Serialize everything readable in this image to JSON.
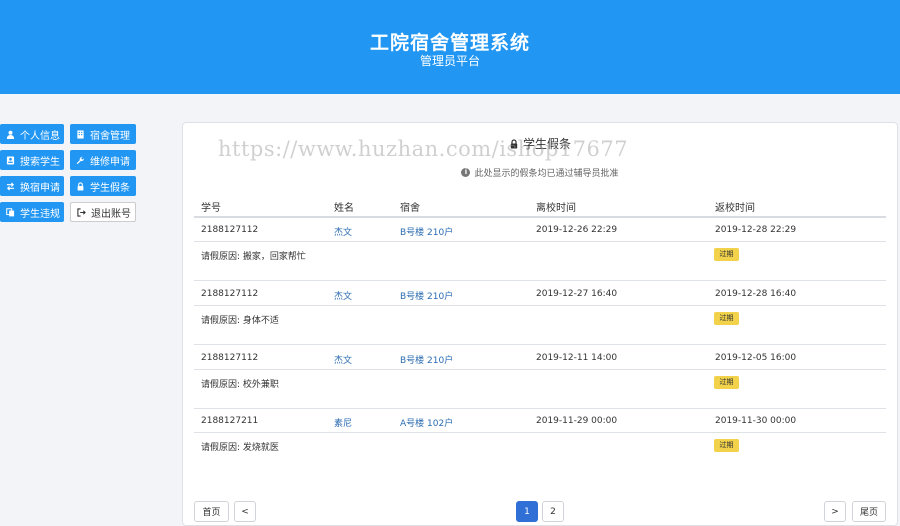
{
  "header": {
    "title": "工院宿舍管理系统",
    "subtitle": "管理员平台"
  },
  "sidebar": {
    "items": [
      {
        "label": "个人信息",
        "icon": "user-icon"
      },
      {
        "label": "宿舍管理",
        "icon": "building-icon"
      },
      {
        "label": "搜索学生",
        "icon": "id-card-icon"
      },
      {
        "label": "维修申请",
        "icon": "wrench-icon"
      },
      {
        "label": "换宿申请",
        "icon": "exchange-icon"
      },
      {
        "label": "学生假条",
        "icon": "lock-icon"
      },
      {
        "label": "学生违规",
        "icon": "copy-icon"
      },
      {
        "label": "退出账号",
        "icon": "sign-out-icon"
      }
    ]
  },
  "card": {
    "title": "学生假条",
    "note": "此处显示的假条均已通过辅导员批准"
  },
  "watermark": "https://www.huzhan.com/ishop17677",
  "table": {
    "columns": [
      "学号",
      "姓名",
      "宿舍",
      "离校时间",
      "返校时间"
    ],
    "rows": [
      {
        "id": "2188127112",
        "name": "杰文",
        "dorm": "B号楼 210户",
        "leave": "2019-12-26 22:29",
        "return": "2019-12-28 22:29",
        "reason": "请假原因: 搬家，回家帮忙",
        "status": "过期"
      },
      {
        "id": "2188127112",
        "name": "杰文",
        "dorm": "B号楼 210户",
        "leave": "2019-12-27 16:40",
        "return": "2019-12-28 16:40",
        "reason": "请假原因: 身体不适",
        "status": "过期"
      },
      {
        "id": "2188127112",
        "name": "杰文",
        "dorm": "B号楼 210户",
        "leave": "2019-12-11 14:00",
        "return": "2019-12-05 16:00",
        "reason": "请假原因: 校外兼职",
        "status": "过期"
      },
      {
        "id": "2188127211",
        "name": "素尼",
        "dorm": "A号楼 102户",
        "leave": "2019-11-29 00:00",
        "return": "2019-11-30 00:00",
        "reason": "请假原因: 发烧就医",
        "status": "过期"
      }
    ]
  },
  "pagination": {
    "first": "首页",
    "prev": "<",
    "pages": [
      "1",
      "2"
    ],
    "current": "1",
    "next": ">",
    "last": "尾页"
  }
}
